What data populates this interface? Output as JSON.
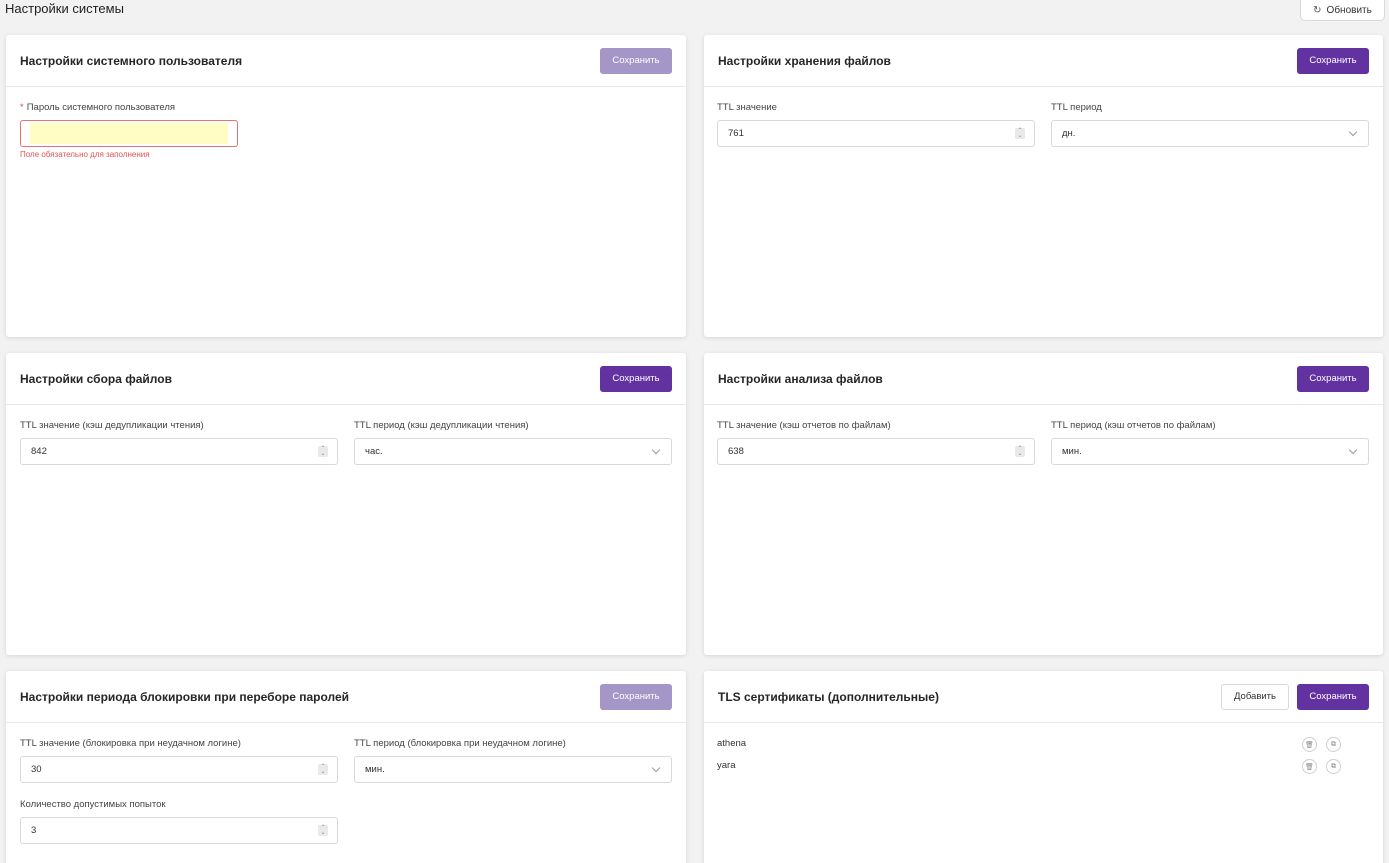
{
  "page": {
    "title": "Настройки системы",
    "refresh_label": "Обновить"
  },
  "cards": {
    "system_user": {
      "title": "Настройки системного пользователя",
      "save_label": "Сохранить",
      "password_label": "Пароль системного пользователя",
      "required_mark": "*",
      "error": "Поле обязательно для заполнения"
    },
    "file_storage": {
      "title": "Настройки хранения файлов",
      "save_label": "Сохранить",
      "ttl_value_label": "TTL значение",
      "ttl_value": "761",
      "ttl_period_label": "TTL период",
      "ttl_period": "дн."
    },
    "file_collection": {
      "title": "Настройки сбора файлов",
      "save_label": "Сохранить",
      "ttl_value_label": "TTL значение (кэш дедупликации чтения)",
      "ttl_value": "842",
      "ttl_period_label": "TTL период (кэш дедупликации чтения)",
      "ttl_period": "час."
    },
    "file_analysis": {
      "title": "Настройки анализа файлов",
      "save_label": "Сохранить",
      "ttl_value_label": "TTL значение (кэш отчетов по файлам)",
      "ttl_value": "638",
      "ttl_period_label": "TTL период (кэш отчетов по файлам)",
      "ttl_period": "мин."
    },
    "lockout": {
      "title": "Настройки периода блокировки при переборе паролей",
      "save_label": "Сохранить",
      "ttl_value_label": "TTL значение (блокировка при неудачном логине)",
      "ttl_value": "30",
      "ttl_period_label": "TTL период (блокировка при неудачном логине)",
      "ttl_period": "мин.",
      "attempts_label": "Количество допустимых попыток",
      "attempts_value": "3"
    },
    "tls": {
      "title": "TLS сертификаты (дополнительные)",
      "add_label": "Добавить",
      "save_label": "Сохранить",
      "items": [
        "athena",
        "yara"
      ]
    }
  },
  "colors": {
    "primary": "#6232a0",
    "primary_disabled": "#a496c6",
    "error": "#e05252"
  }
}
